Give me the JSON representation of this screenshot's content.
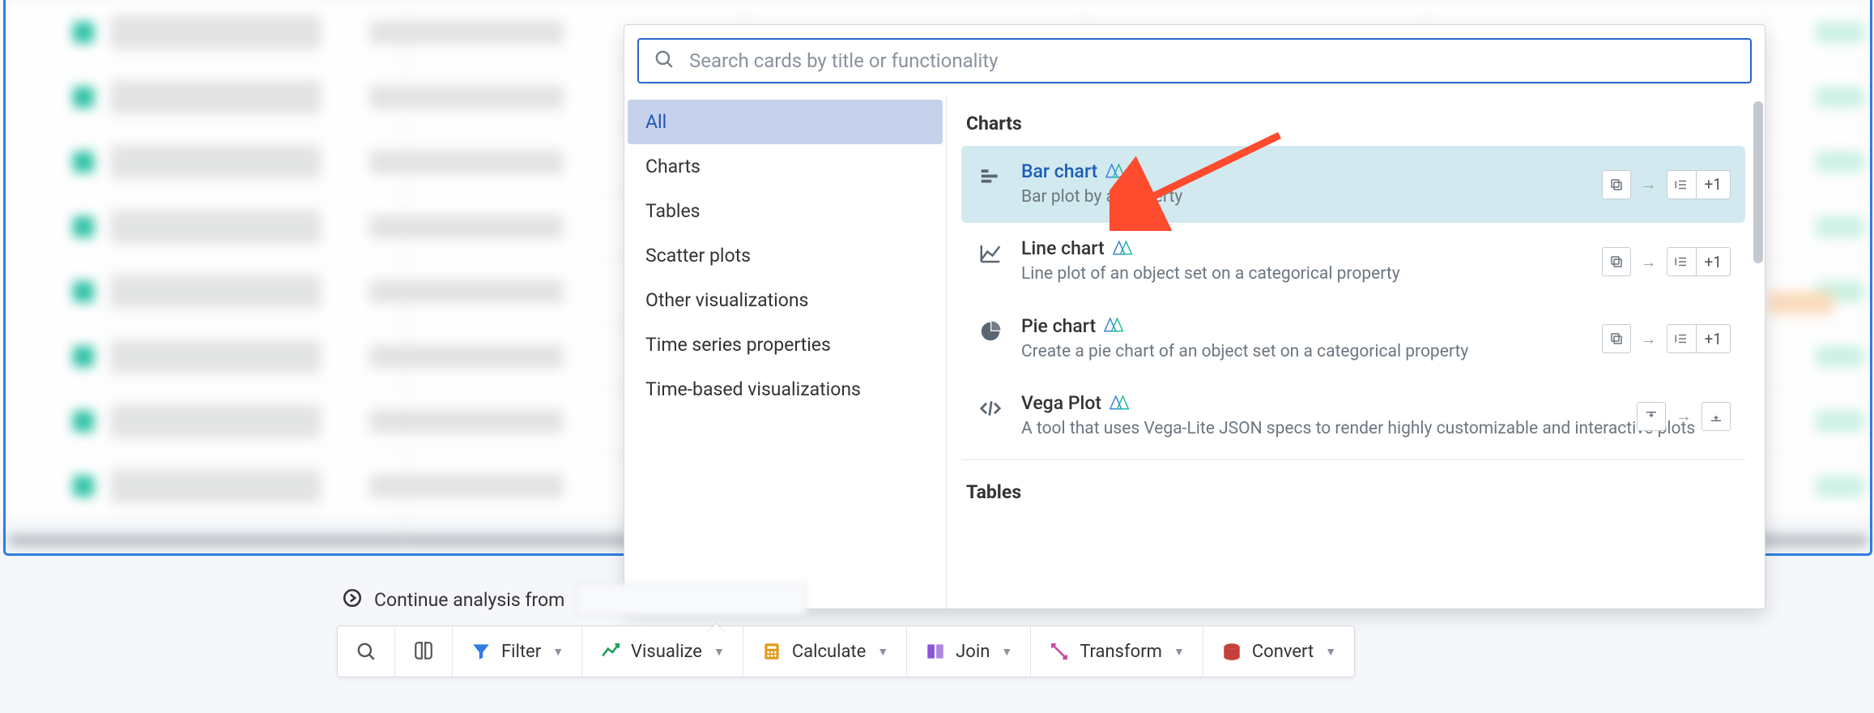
{
  "search": {
    "placeholder": "Search cards by title or functionality"
  },
  "sidebar": {
    "items": [
      {
        "label": "All",
        "active": true
      },
      {
        "label": "Charts"
      },
      {
        "label": "Tables"
      },
      {
        "label": "Scatter plots"
      },
      {
        "label": "Other visualizations"
      },
      {
        "label": "Time series properties"
      },
      {
        "label": "Time-based visualizations"
      }
    ]
  },
  "section_charts_title": "Charts",
  "section_tables_title": "Tables",
  "cards": [
    {
      "title": "Bar chart",
      "desc": "Bar plot by a property",
      "plus": "+1",
      "selected": true
    },
    {
      "title": "Line chart",
      "desc": "Line plot of an object set on a categorical property",
      "plus": "+1"
    },
    {
      "title": "Pie chart",
      "desc": "Create a pie chart of an object set on a categorical property",
      "plus": "+1"
    },
    {
      "title": "Vega Plot",
      "desc": "A tool that uses Vega-Lite JSON specs to render highly customizable and interactive plots"
    }
  ],
  "continue_label": "Continue analysis from",
  "toolbar": {
    "filter": "Filter",
    "visualize": "Visualize",
    "calculate": "Calculate",
    "join": "Join",
    "transform": "Transform",
    "convert": "Convert"
  }
}
